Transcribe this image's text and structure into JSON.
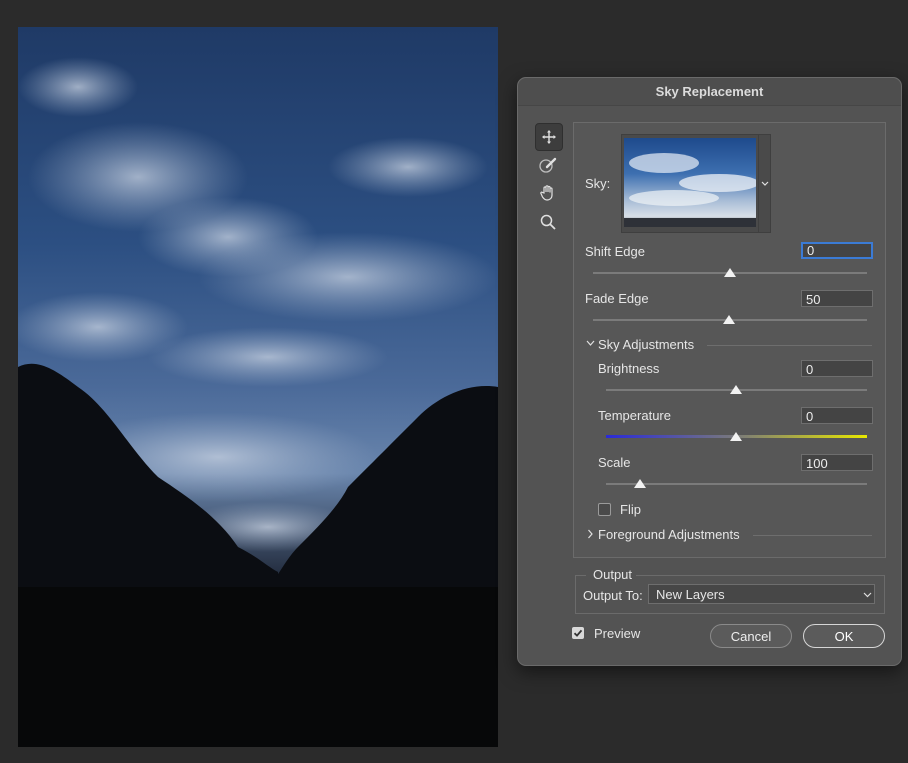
{
  "dialog": {
    "title": "Sky Replacement",
    "sky_label": "Sky:",
    "sliders": {
      "shift_edge": {
        "label": "Shift Edge",
        "value": "0",
        "position": 0.5
      },
      "fade_edge": {
        "label": "Fade Edge",
        "value": "50",
        "position": 0.5
      },
      "brightness": {
        "label": "Brightness",
        "value": "0",
        "position": 0.5
      },
      "temperature": {
        "label": "Temperature",
        "value": "0",
        "position": 0.5
      },
      "scale": {
        "label": "Scale",
        "value": "100",
        "position": 0.13
      }
    },
    "sky_adjustments_label": "Sky Adjustments",
    "flip_label": "Flip",
    "flip_checked": false,
    "foreground_adjustments_label": "Foreground Adjustments",
    "output": {
      "section_label": "Output",
      "output_to_label": "Output To:",
      "output_to_value": "New Layers"
    },
    "preview_label": "Preview",
    "preview_checked": true,
    "cancel_label": "Cancel",
    "ok_label": "OK"
  },
  "tools": [
    "move-sky-icon",
    "sky-brush-icon",
    "hand-icon",
    "zoom-icon"
  ],
  "colors": {
    "temperature_left": "#2a2ad8",
    "temperature_right": "#e8e800",
    "focus": "#3b7bd5"
  }
}
